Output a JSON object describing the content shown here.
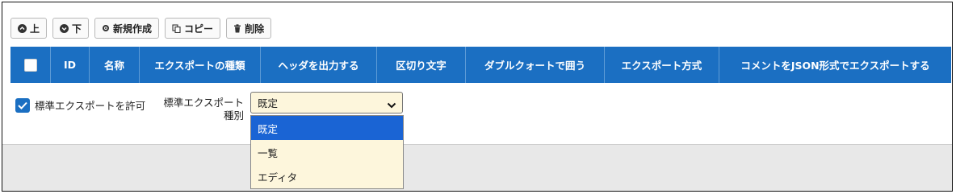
{
  "toolbar": {
    "up_label": "上",
    "down_label": "下",
    "new_label": "新規作成",
    "copy_label": "コピー",
    "delete_label": "削除"
  },
  "grid": {
    "columns": [
      "ID",
      "名称",
      "エクスポートの種類",
      "ヘッダを出力する",
      "区切り文字",
      "ダブルクォートで囲う",
      "エクスポート方式",
      "コメントをJSON形式でエクスポートする"
    ]
  },
  "options": {
    "allow_standard_export_label": "標準エクスポートを許可",
    "allow_standard_export_checked": true,
    "export_type_label": "標準エクスポート種別",
    "export_type_value": "既定",
    "export_type_options": [
      "既定",
      "一覧",
      "エディタ"
    ],
    "export_type_selected_index": 0
  },
  "colors": {
    "accent": "#1b6fc2",
    "dropdown_bg": "#fdf6dc",
    "dropdown_selected": "#1a64d4"
  }
}
